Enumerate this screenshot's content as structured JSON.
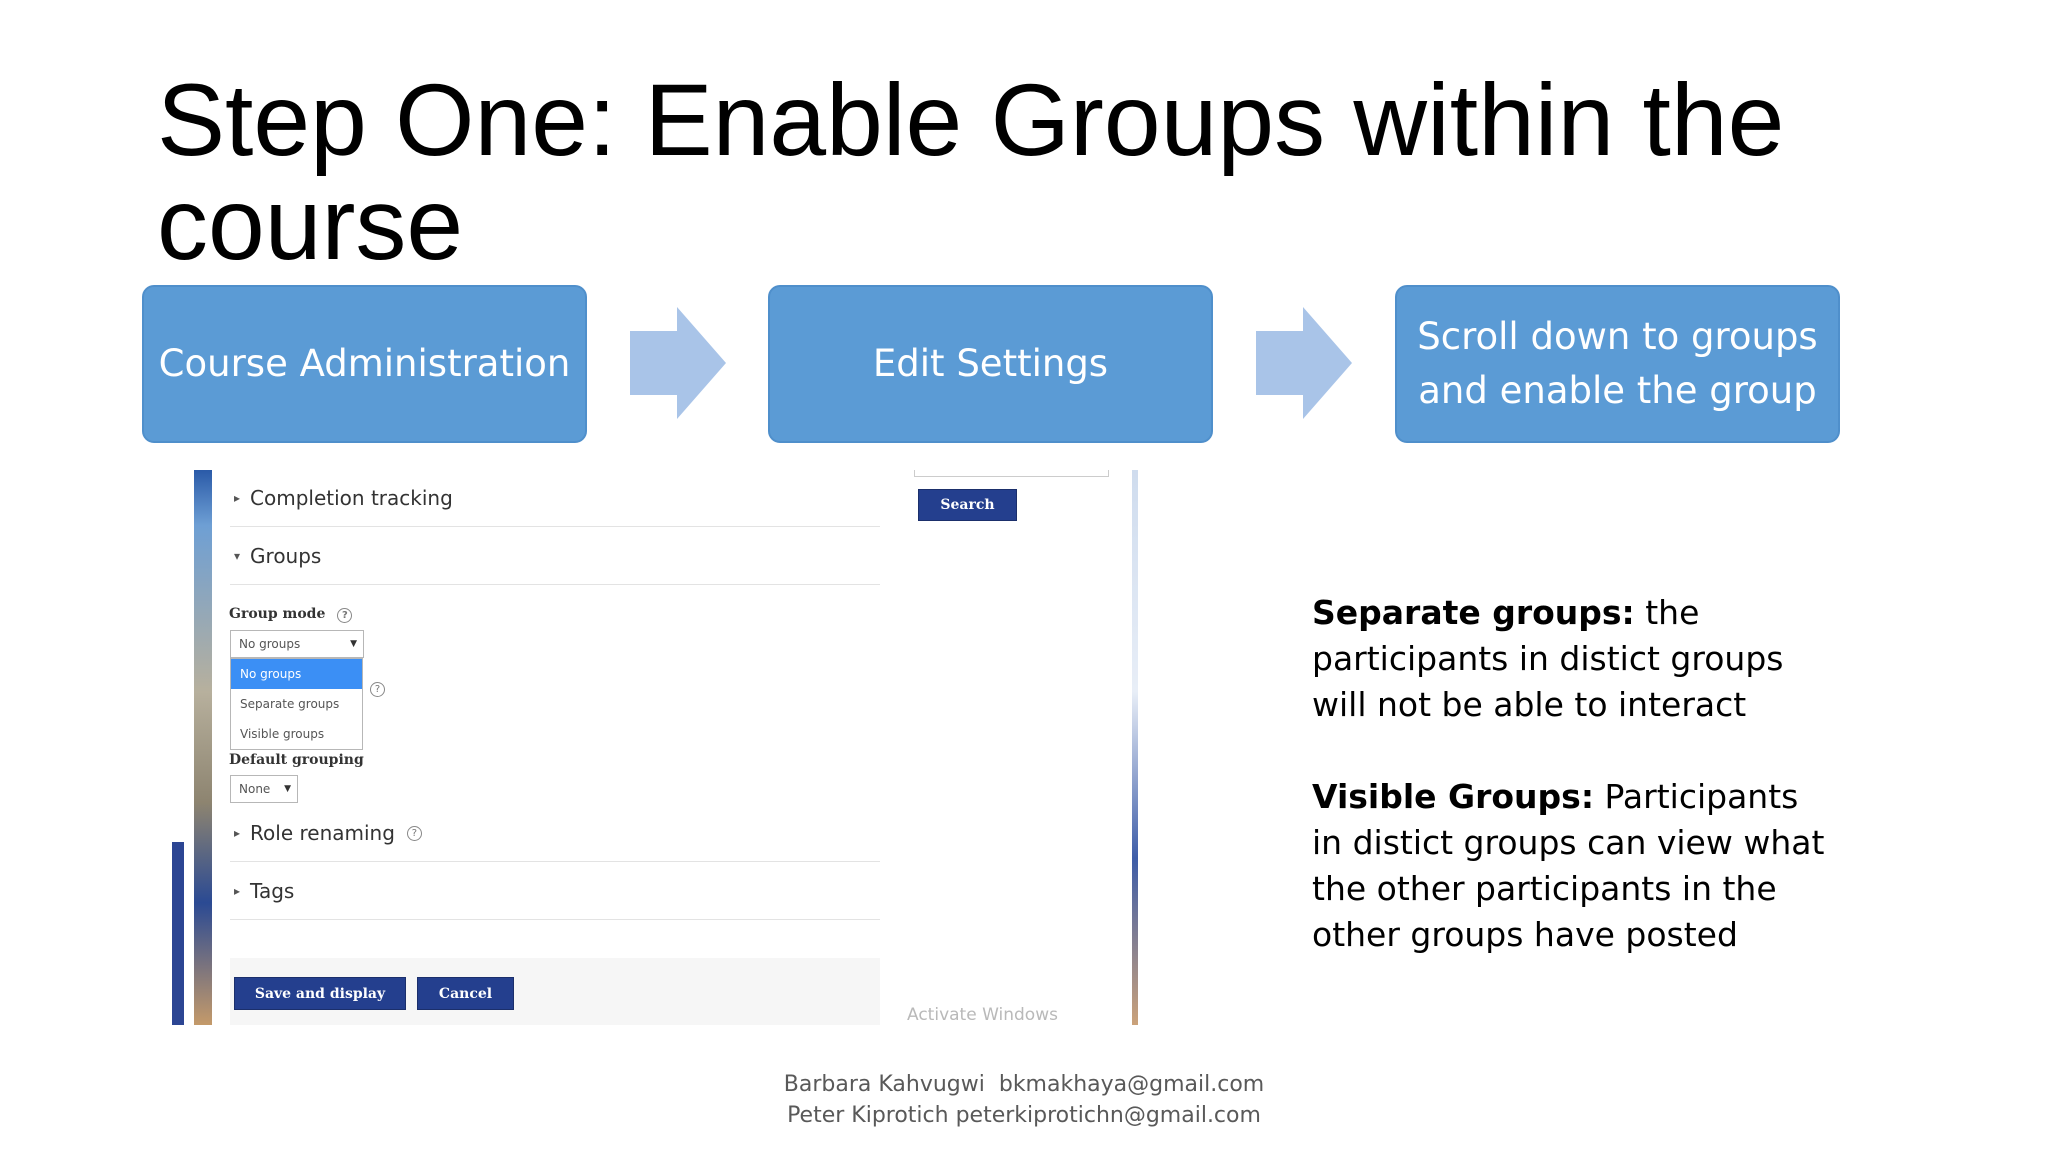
{
  "slide": {
    "title": "Step One: Enable Groups within the course"
  },
  "steps": [
    {
      "label": "Course Administration"
    },
    {
      "label": "Edit Settings"
    },
    {
      "label": "Scroll down to groups and enable the group"
    }
  ],
  "colors": {
    "step_box": "#5b9bd5",
    "arrow": "#a9c4e8",
    "moodle_button": "#243f8e",
    "selected_option": "#3b8ff5"
  },
  "icons": {
    "arrow": "right-arrow-icon",
    "help": "help-circle-icon",
    "collapsed": "triangle-right-icon",
    "expanded": "triangle-down-icon"
  },
  "screenshot": {
    "search_button": "Search",
    "sections": {
      "completion_tracking": "Completion tracking",
      "groups": "Groups",
      "role_renaming": "Role renaming",
      "tags": "Tags"
    },
    "group_mode": {
      "label": "Group mode",
      "selected": "No groups",
      "options": [
        "No groups",
        "Separate groups",
        "Visible groups"
      ]
    },
    "default_grouping": {
      "label": "Default grouping",
      "selected": "None"
    },
    "buttons": {
      "save": "Save and display",
      "cancel": "Cancel"
    },
    "watermark": "Activate Windows"
  },
  "description": {
    "separate": {
      "term": "Separate groups:",
      "text": " the participants in distict groups will not be able to interact"
    },
    "visible": {
      "term": "Visible Groups:",
      "text": " Participants in distict groups can view what the other participants in the other groups have posted"
    }
  },
  "authors": {
    "line1": "Barbara Kahvugwi  bkmakhaya@gmail.com",
    "line2": "Peter Kiprotich peterkiprotichn@gmail.com"
  }
}
